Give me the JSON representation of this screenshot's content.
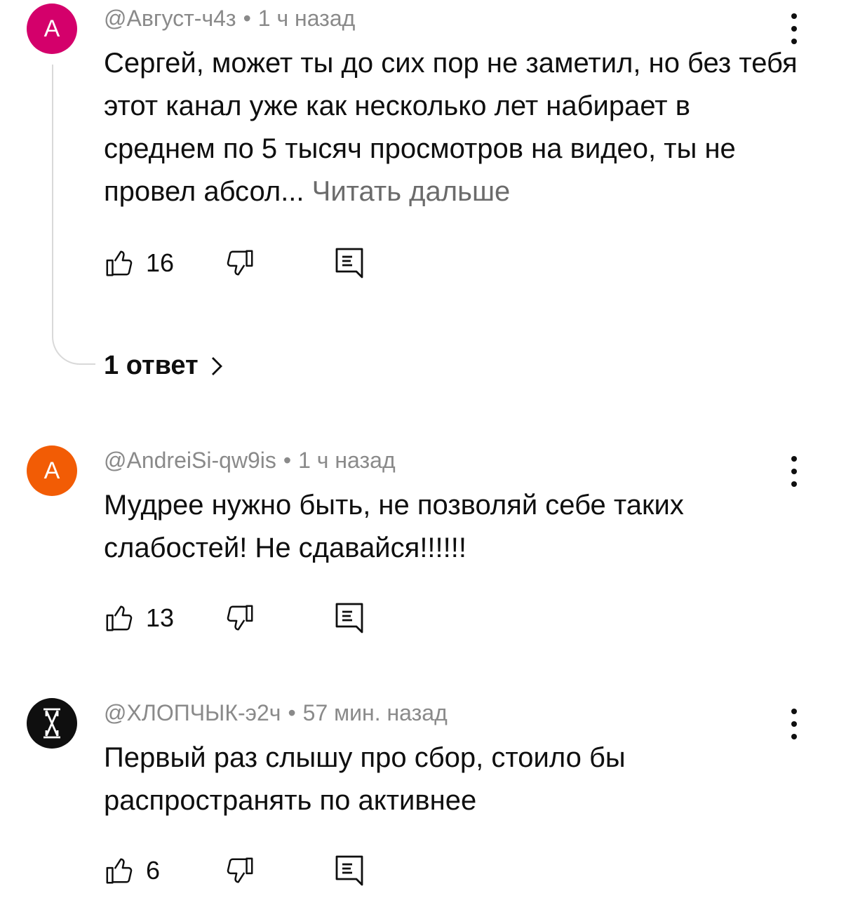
{
  "comments": [
    {
      "avatar_letter": "A",
      "avatar_color": "#d4006b",
      "author": "@Август-ч4з",
      "time": "1 ч назад",
      "text": "Сергей, может ты до сих пор не заметил, но без тебя этот канал уже как несколько лет набирает в среднем по 5 тысяч просмотров на видео, ты не провел абсол...",
      "read_more": "Читать дальше",
      "likes": "16",
      "replies_label": "1 ответ"
    },
    {
      "avatar_letter": "A",
      "avatar_color": "#f25c05",
      "author": "@AndreiSi-qw9is",
      "time": "1 ч назад",
      "text": "Мудрее нужно быть, не позволяй себе таких слабостей! Не сдавайся!!!!!!",
      "likes": "13"
    },
    {
      "avatar_icon": "hourglass-x-logo-icon",
      "avatar_color": "#0f0f0f",
      "author": "@ХЛОПЧЫК-э2ч",
      "time": "57 мин. назад",
      "text": "Первый раз слышу про сбор, стоило бы распространять по активнее",
      "likes": "6"
    }
  ],
  "icons": {
    "like": "thumb-up-icon",
    "dislike": "thumb-down-icon",
    "reply": "reply-comment-icon",
    "more": "more-vertical-icon",
    "chevron": "chevron-right-icon"
  },
  "colors": {
    "meta_text": "#8a8a8a",
    "read_more": "#6b6b6b",
    "primary_text": "#0f0f0f",
    "thread_line": "#d9d9d9"
  }
}
